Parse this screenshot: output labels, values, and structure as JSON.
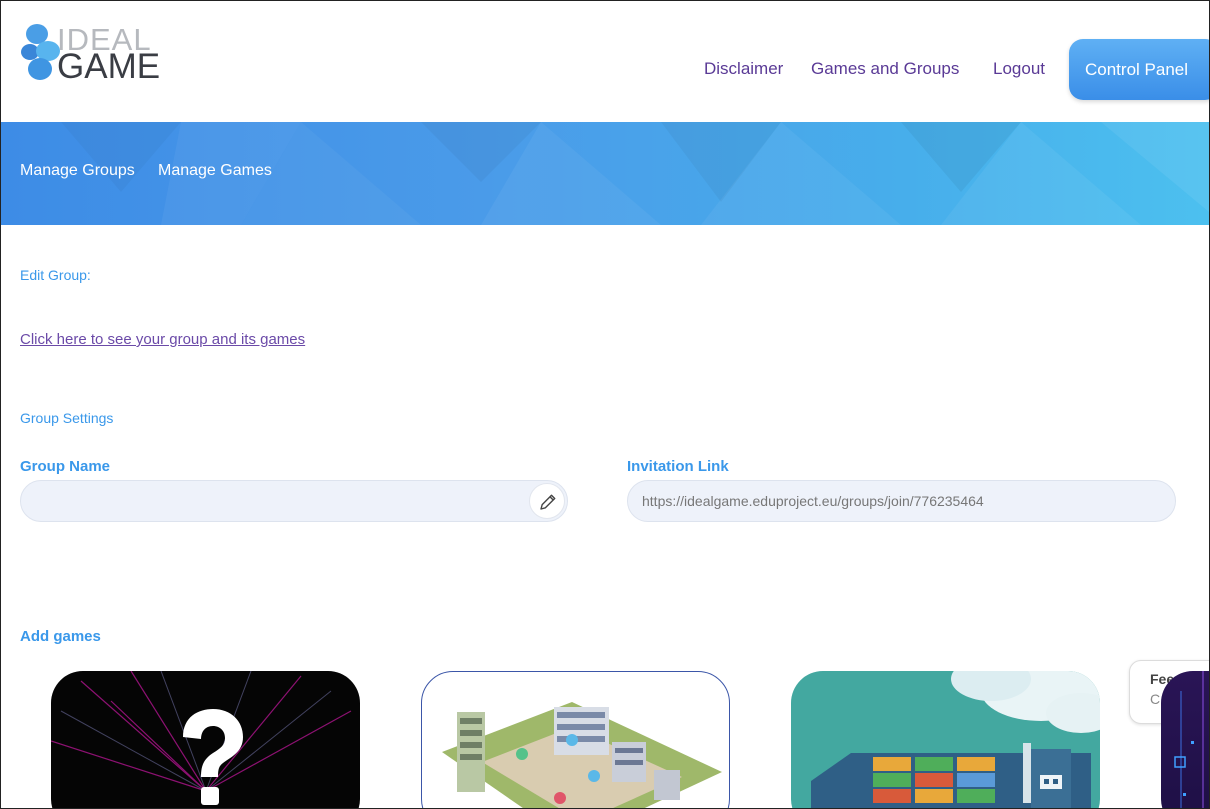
{
  "brand": {
    "line1": "IDEAL",
    "line2": "GAME"
  },
  "nav": {
    "disclaimer": "Disclaimer",
    "games_and_groups": "Games and Groups",
    "logout": "Logout",
    "control_panel": "Control Panel"
  },
  "subnav": {
    "manage_groups": "Manage Groups",
    "manage_games": "Manage Games"
  },
  "content": {
    "edit_group_label": "Edit Group:",
    "group_link": "Click here to see your group and its games",
    "group_settings_label": "Group Settings",
    "group_name_label": "Group Name",
    "group_name_value": "",
    "invitation_link_label": "Invitation Link",
    "invitation_link_value": "https://idealgame.eduproject.eu/groups/join/776235464",
    "add_games_label": "Add games"
  },
  "feedback": {
    "title": "Fee",
    "subtitle": "C"
  },
  "colors": {
    "link_purple": "#5a3a96",
    "accent_blue": "#3a98ea",
    "banner_blue": "#3d8ce6"
  },
  "icons": {
    "edit": "pencil-icon",
    "logo": "droplets-logo-icon",
    "mystery_game": "question-mark-icon"
  }
}
